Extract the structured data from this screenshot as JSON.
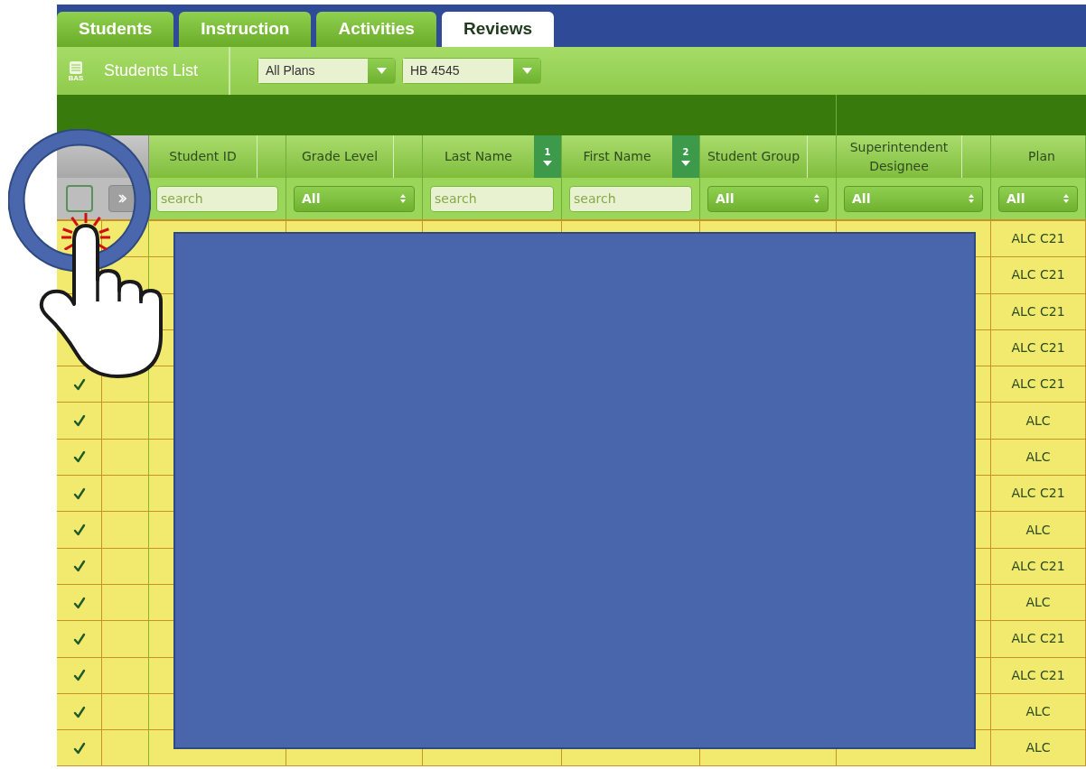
{
  "tabs": [
    {
      "label": "Students",
      "selected": false
    },
    {
      "label": "Instruction",
      "selected": false
    },
    {
      "label": "Activities",
      "selected": false
    },
    {
      "label": "Reviews",
      "selected": true
    }
  ],
  "toolbar": {
    "logo_text": "BAS",
    "title": "Students List",
    "dropdowns": [
      {
        "value": "All Plans"
      },
      {
        "value": "HB 4545"
      }
    ]
  },
  "table": {
    "select_all": {
      "checked": false
    },
    "columns": [
      {
        "label": "Student ID",
        "filter": {
          "kind": "search",
          "placeholder": "search"
        }
      },
      {
        "label": "Grade Level",
        "filter": {
          "kind": "select",
          "value": "All"
        }
      },
      {
        "label": "Last Name",
        "sort_order": "1",
        "filter": {
          "kind": "search",
          "placeholder": "search"
        }
      },
      {
        "label": "First Name",
        "sort_order": "2",
        "filter": {
          "kind": "search",
          "placeholder": "search"
        }
      },
      {
        "label": "Student Group",
        "filter": {
          "kind": "select",
          "value": "All"
        }
      },
      {
        "label": "Superintendent Designee",
        "filter": {
          "kind": "select",
          "value": "All"
        }
      },
      {
        "label": "Plan",
        "filter": {
          "kind": "select",
          "value": "All"
        }
      }
    ],
    "rows": [
      {
        "plan": "ALC C21"
      },
      {
        "plan": "ALC C21"
      },
      {
        "plan": "ALC C21"
      },
      {
        "plan": "ALC C21"
      },
      {
        "checked": true,
        "plan": "ALC C21"
      },
      {
        "checked": true,
        "plan": "ALC"
      },
      {
        "checked": true,
        "plan": "ALC"
      },
      {
        "checked": true,
        "plan": "ALC C21"
      },
      {
        "checked": true,
        "plan": "ALC"
      },
      {
        "checked": true,
        "plan": "ALC C21"
      },
      {
        "checked": true,
        "plan": "ALC"
      },
      {
        "checked": true,
        "plan": "ALC C21"
      },
      {
        "checked": true,
        "plan": "ALC C21"
      },
      {
        "checked": true,
        "plan": "ALC"
      },
      {
        "checked": true,
        "plan": "ALC"
      }
    ]
  }
}
